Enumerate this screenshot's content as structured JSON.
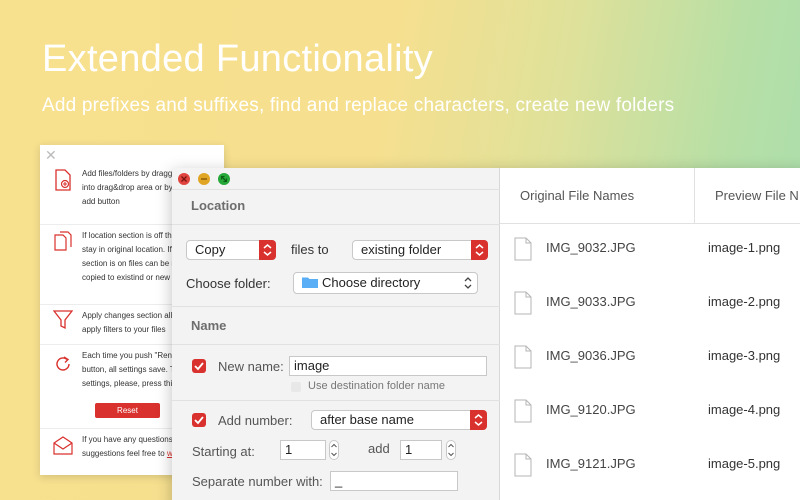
{
  "hero": {
    "title": "Extended Functionality",
    "subtitle": "Add prefixes and suffixes, find and replace characters, create new folders"
  },
  "help_panel": {
    "items": [
      {
        "icon": "add-file-icon",
        "lines": [
          "Add files/folders by draggi",
          "into drag&drop area or by p",
          "add button"
        ]
      },
      {
        "icon": "copy-files-icon",
        "lines": [
          "If location section is off the",
          "stay in original location. If l",
          "section is on files can be m",
          "copied to existind or new f"
        ]
      },
      {
        "icon": "filter-icon",
        "lines": [
          "Apply changes section allo",
          "apply filters to your files"
        ]
      },
      {
        "icon": "refresh-icon",
        "lines": [
          "Each time you push \"Rena",
          "button, all settings save. T",
          "settings, please, press this"
        ]
      },
      {
        "icon": "mail-icon",
        "lines": [
          "If you have any questions",
          "suggestions feel free to "
        ],
        "link": "wr"
      }
    ],
    "reset_label": "Reset"
  },
  "location": {
    "header": "Location",
    "action_value": "Copy",
    "files_to_label": "files to",
    "destination_value": "existing folder",
    "choose_folder_label": "Choose folder:",
    "directory_value": "Choose directory"
  },
  "name": {
    "header": "Name",
    "new_name_label": "New name:",
    "new_name_value": "image",
    "use_dest_label": "Use destination folder name",
    "add_number_label": "Add number:",
    "add_number_value": "after base name",
    "starting_at_label": "Starting at:",
    "starting_at_value": "1",
    "add_label": "add",
    "add_value": "1",
    "separate_label": "Separate number with:",
    "separate_value": "_"
  },
  "file_list": {
    "col_original": "Original File Names",
    "col_preview": "Preview File N",
    "rows": [
      {
        "original": "IMG_9032.JPG",
        "preview": "image-1.png"
      },
      {
        "original": "IMG_9033.JPG",
        "preview": "image-2.png"
      },
      {
        "original": "IMG_9036.JPG",
        "preview": "image-3.png"
      },
      {
        "original": "IMG_9120.JPG",
        "preview": "image-4.png"
      },
      {
        "original": "IMG_9121.JPG",
        "preview": "image-5.png"
      }
    ]
  },
  "colors": {
    "accent": "#d9312d",
    "folder_blue": "#5aaef5"
  }
}
